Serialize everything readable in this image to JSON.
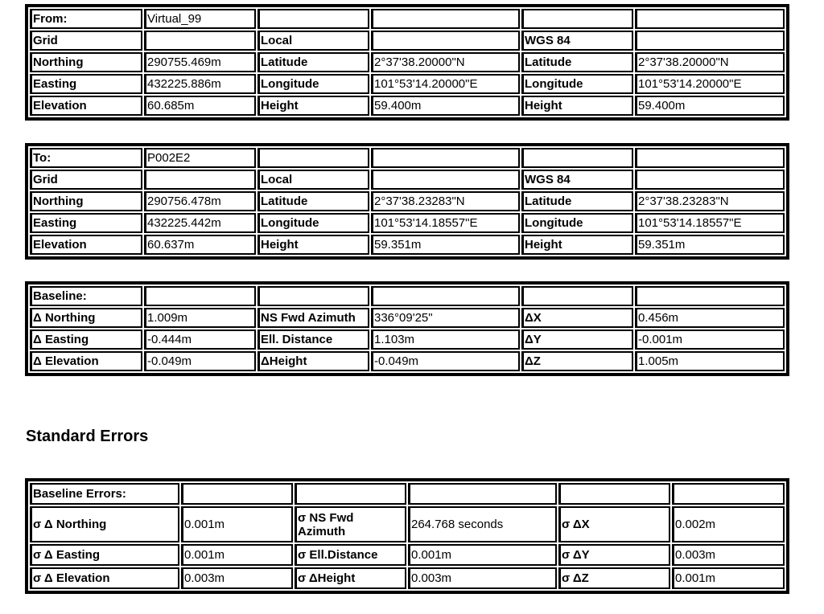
{
  "from_table": {
    "rows": [
      [
        "From:",
        "Virtual_99",
        "",
        "",
        "",
        ""
      ],
      [
        "Grid",
        "",
        "Local",
        "",
        "WGS 84",
        ""
      ],
      [
        "Northing",
        "290755.469m",
        "Latitude",
        "2°37'38.20000\"N",
        "Latitude",
        "2°37'38.20000\"N"
      ],
      [
        "Easting",
        "432225.886m",
        "Longitude",
        "101°53'14.20000\"E",
        "Longitude",
        "101°53'14.20000\"E"
      ],
      [
        "Elevation",
        "60.685m",
        "Height",
        "59.400m",
        "Height",
        "59.400m"
      ]
    ]
  },
  "to_table": {
    "rows": [
      [
        "To:",
        "P002E2",
        "",
        "",
        "",
        ""
      ],
      [
        "Grid",
        "",
        "Local",
        "",
        "WGS 84",
        ""
      ],
      [
        "Northing",
        "290756.478m",
        "Latitude",
        "2°37'38.23283\"N",
        "Latitude",
        "2°37'38.23283\"N"
      ],
      [
        "Easting",
        "432225.442m",
        "Longitude",
        "101°53'14.18557\"E",
        "Longitude",
        "101°53'14.18557\"E"
      ],
      [
        "Elevation",
        "60.637m",
        "Height",
        "59.351m",
        "Height",
        "59.351m"
      ]
    ]
  },
  "baseline_table": {
    "rows": [
      [
        "Baseline:",
        "",
        "",
        "",
        "",
        ""
      ],
      [
        "Δ Northing",
        "1.009m",
        "NS Fwd Azimuth",
        "336°09'25\"",
        "ΔX",
        "0.456m"
      ],
      [
        "Δ Easting",
        "-0.444m",
        "Ell. Distance",
        "1.103m",
        "ΔY",
        "-0.001m"
      ],
      [
        "Δ Elevation",
        "-0.049m",
        "ΔHeight",
        "-0.049m",
        "ΔZ",
        "1.005m"
      ]
    ]
  },
  "section_title": "Standard Errors",
  "errors_table": {
    "rows": [
      [
        "Baseline Errors:",
        "",
        "",
        "",
        "",
        ""
      ],
      [
        "σ Δ Northing",
        "0.001m",
        "σ NS Fwd Azimuth",
        "264.768 seconds",
        "σ ΔX",
        "0.002m"
      ],
      [
        "σ Δ Easting",
        "0.001m",
        "σ Ell.Distance",
        "0.001m",
        "σ ΔY",
        "0.003m"
      ],
      [
        "σ Δ Elevation",
        "0.003m",
        "σ ΔHeight",
        "0.003m",
        "σ ΔZ",
        "0.001m"
      ]
    ]
  }
}
